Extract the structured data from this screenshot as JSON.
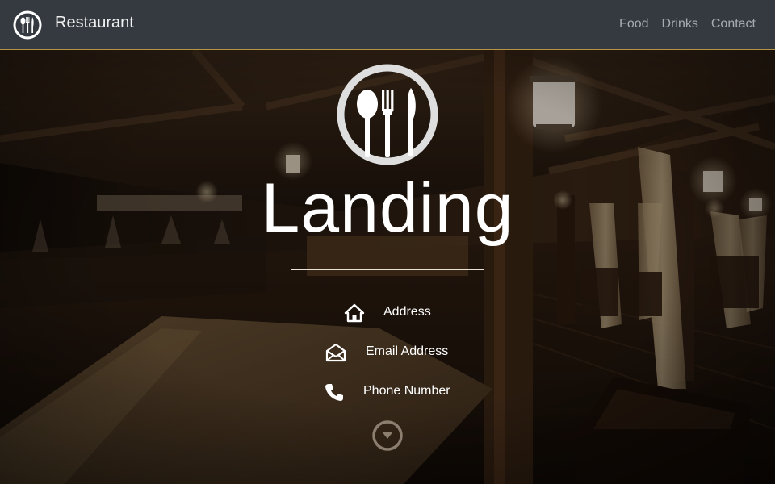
{
  "navbar": {
    "brand": "Restaurant",
    "logo_icon": "cutlery-circle-icon",
    "links": [
      {
        "label": "Food"
      },
      {
        "label": "Drinks"
      },
      {
        "label": "Contact"
      }
    ],
    "background_color": "#343a40",
    "border_color": "#b59448"
  },
  "hero": {
    "title": "Landing",
    "logo_icon": "cutlery-circle-icon",
    "contacts": [
      {
        "icon": "home-icon",
        "label": "Address"
      },
      {
        "icon": "envelope-icon",
        "label": "Email Address"
      },
      {
        "icon": "phone-icon",
        "label": "Phone Number"
      }
    ],
    "scroll_icon": "chevron-down-circle-icon"
  }
}
